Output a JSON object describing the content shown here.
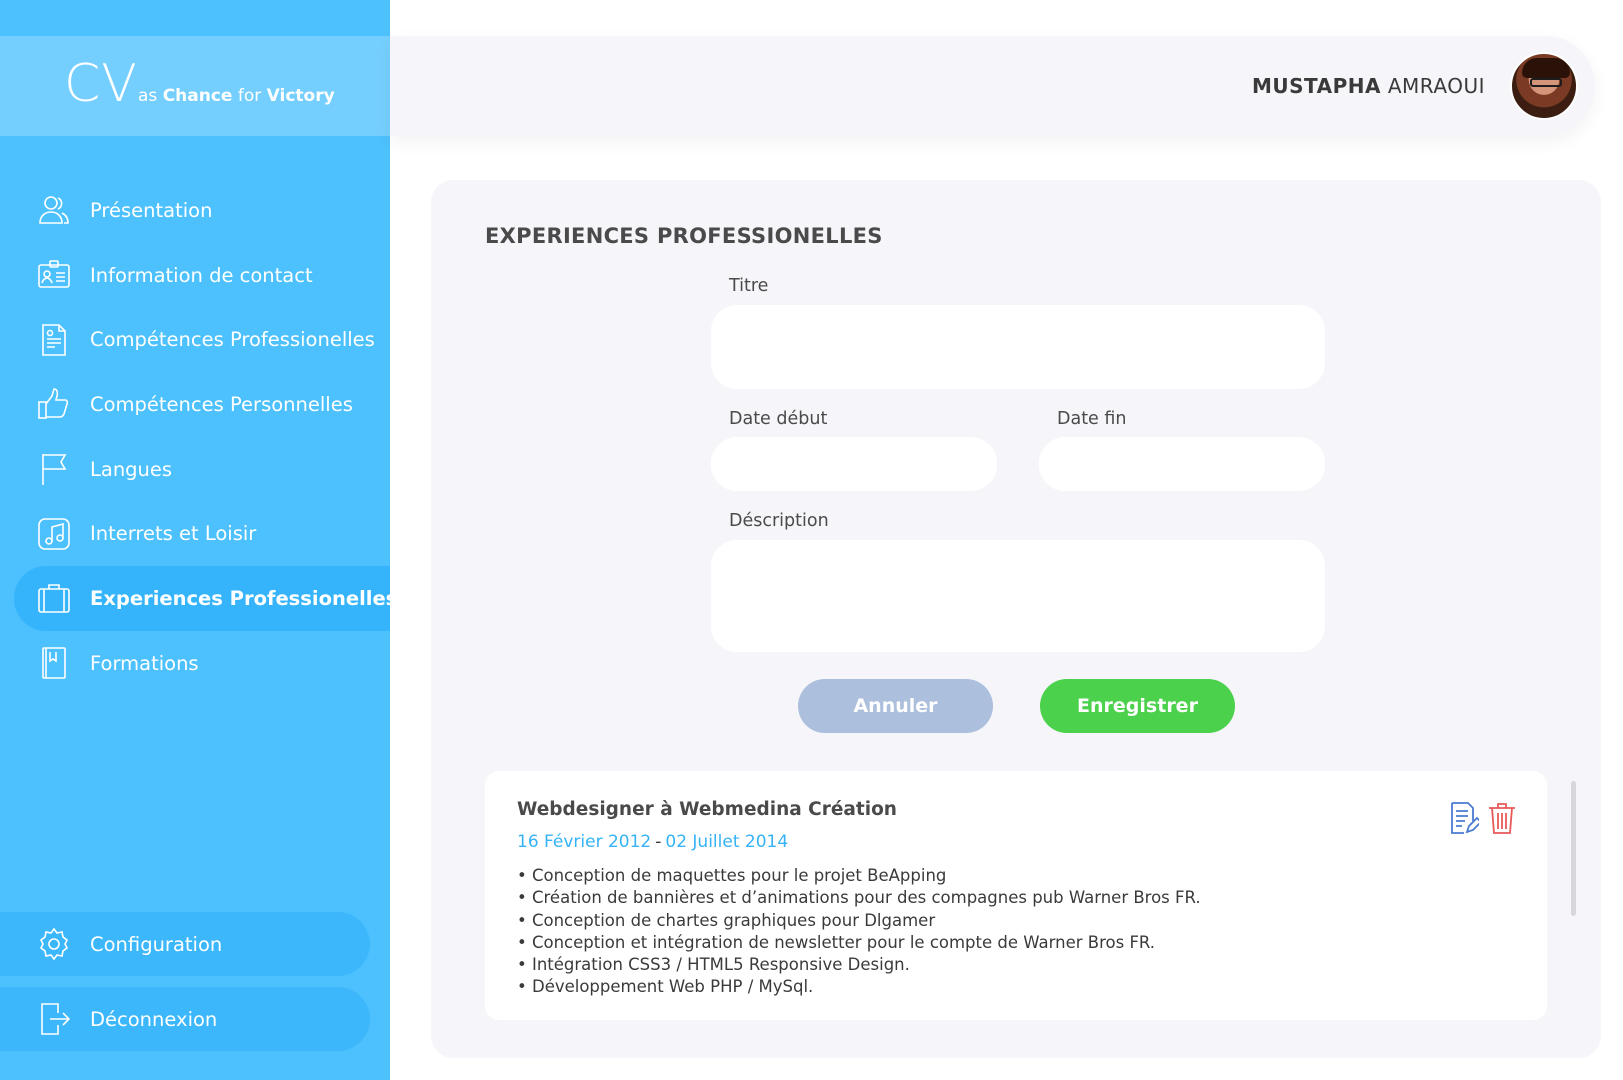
{
  "brand": {
    "logo": "CV",
    "tag_prefix": "as",
    "tag_word1": "Chance",
    "tag_middle": "for",
    "tag_word2": "Victory"
  },
  "sidebar": {
    "items": [
      {
        "label": "Présentation",
        "icon": "users-icon"
      },
      {
        "label": "Information de contact",
        "icon": "id-card-icon"
      },
      {
        "label": "Compétences Professionelles",
        "icon": "document-icon"
      },
      {
        "label": "Compétences Personnelles",
        "icon": "thumbs-up-icon"
      },
      {
        "label": "Langues",
        "icon": "flag-icon"
      },
      {
        "label": "Interrets et Loisir",
        "icon": "music-icon"
      },
      {
        "label": "Experiences Professionelles",
        "icon": "briefcase-icon",
        "active": true
      },
      {
        "label": "Formations",
        "icon": "book-icon"
      }
    ],
    "config_label": "Configuration",
    "logout_label": "Déconnexion"
  },
  "header": {
    "first_name": "MUSTAPHA",
    "last_name": "AMRAOUI"
  },
  "form": {
    "section_title": "EXPERIENCES PROFESSIONELLES",
    "titre_label": "Titre",
    "titre_value": "",
    "date_debut_label": "Date début",
    "date_debut_value": "",
    "date_fin_label": "Date fin",
    "date_fin_value": "",
    "description_label": "Déscription",
    "description_value": "",
    "cancel_label": "Annuler",
    "save_label": "Enregistrer"
  },
  "experiences": [
    {
      "title": "Webdesigner à Webmedina Création",
      "start": "16 Février 2012",
      "separator": "-",
      "end": "02 Juillet 2014",
      "bullets": [
        "Conception de maquettes pour le projet BeApping",
        "Création de bannières et d’animations pour des compagnes pub Warner Bros FR.",
        "Conception de chartes graphiques pour Dlgamer",
        "Conception et intégration de newsletter pour le compte de Warner Bros FR.",
        "Intégration CSS3 / HTML5 Responsive Design.",
        "Développement Web PHP / MySql."
      ]
    }
  ],
  "colors": {
    "sidebar": "#4dc1fd",
    "accent_blue": "#35b3f6",
    "save_green": "#4bd14b",
    "cancel_grey": "#acbfdc",
    "delete_red": "#e85a5a",
    "edit_blue": "#4a7bd0"
  }
}
